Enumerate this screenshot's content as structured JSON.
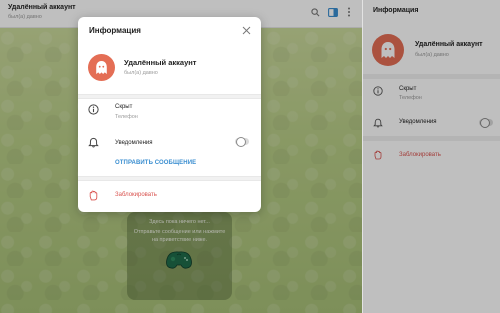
{
  "chat": {
    "title": "Удалённый аккаунт",
    "status": "был(а) давно",
    "empty_title": "Здесь пока ничего нет...",
    "empty_hint": "Отправьте сообщение или нажмите на приветствие ниже."
  },
  "panel": {
    "header": "Информация",
    "name": "Удалённый аккаунт",
    "status": "был(а) давно",
    "phone_value": "Скрыт",
    "phone_label": "Телефон",
    "notifications_label": "Уведомления",
    "block_label": "Заблокировать"
  },
  "modal": {
    "title": "Информация",
    "name": "Удалённый аккаунт",
    "status": "был(а) давно",
    "phone_value": "Скрыт",
    "phone_label": "Телефон",
    "notifications_label": "Уведомления",
    "send_message_label": "ОТПРАВИТЬ СООБЩЕНИЕ",
    "block_label": "Заблокировать",
    "notifications_enabled": false
  },
  "colors": {
    "avatar": "#e46e55",
    "link": "#3a8ed0",
    "danger": "#d9534f"
  }
}
